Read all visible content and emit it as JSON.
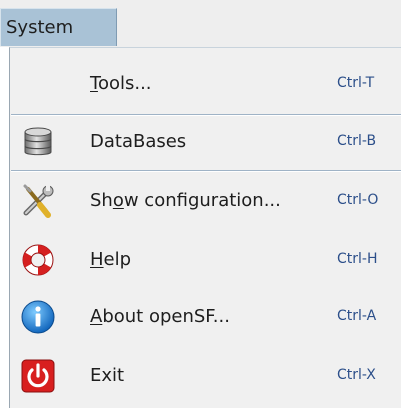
{
  "menubar": {
    "system_label": "System"
  },
  "menu": {
    "items": [
      {
        "pre": "",
        "mnemonic": "T",
        "post": "ools...",
        "shortcut": "Ctrl-T",
        "icon": "none"
      },
      {
        "pre": "DataBases",
        "mnemonic": "",
        "post": "",
        "shortcut": "Ctrl-B",
        "icon": "database-icon"
      },
      {
        "pre": "Sh",
        "mnemonic": "o",
        "post": "w configuration...",
        "shortcut": "Ctrl-O",
        "icon": "tools-icon"
      },
      {
        "pre": "",
        "mnemonic": "H",
        "post": "elp",
        "shortcut": "Ctrl-H",
        "icon": "lifebuoy-icon"
      },
      {
        "pre": "",
        "mnemonic": "A",
        "post": "bout openSF...",
        "shortcut": "Ctrl-A",
        "icon": "info-icon"
      },
      {
        "pre": "Exit",
        "mnemonic": "",
        "post": "",
        "shortcut": "Ctrl-X",
        "icon": "power-icon"
      }
    ]
  },
  "colors": {
    "menubar_bg": "#eeeeee",
    "selected_menu_bg": "#a9c2d6",
    "menu_bg": "#f0f0f0",
    "shortcut_text": "#2c4f8a",
    "separator": "#9fb3c6"
  }
}
